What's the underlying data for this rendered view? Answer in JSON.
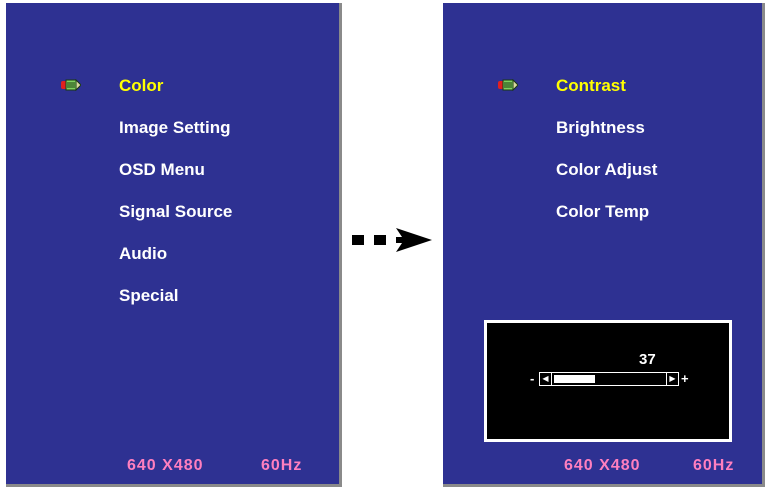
{
  "left_menu": {
    "items": [
      {
        "label": "Color",
        "selected": true
      },
      {
        "label": "Image Setting",
        "selected": false
      },
      {
        "label": "OSD Menu",
        "selected": false
      },
      {
        "label": "Signal Source",
        "selected": false
      },
      {
        "label": "Audio",
        "selected": false
      },
      {
        "label": "Special",
        "selected": false
      }
    ],
    "resolution": "640 X480",
    "refresh": "60Hz"
  },
  "right_menu": {
    "items": [
      {
        "label": "Contrast",
        "selected": true
      },
      {
        "label": "Brightness",
        "selected": false
      },
      {
        "label": "Color Adjust",
        "selected": false
      },
      {
        "label": "Color Temp",
        "selected": false
      }
    ],
    "resolution": "640 X480",
    "refresh": "60Hz"
  },
  "adjust_box": {
    "value": "37",
    "minus": "-",
    "plus": "+",
    "level_fraction": 0.37
  },
  "icons": {
    "selector": "pencil-selector-icon",
    "arrow": "dashed-right-arrow-icon",
    "slider_left": "slider-left-arrow-icon",
    "slider_right": "slider-right-arrow-icon"
  },
  "colors": {
    "panel_bg": "#2e3192",
    "selected_text": "#ffff00",
    "normal_text": "#ffffff",
    "freq_text": "#ff7fbf"
  }
}
